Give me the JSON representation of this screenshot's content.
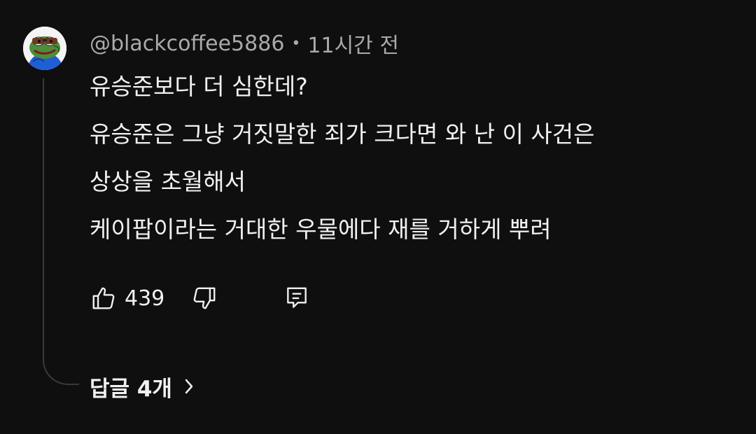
{
  "comment": {
    "author": "@blackcoffee5886",
    "separator": "•",
    "timestamp": "11시간 전",
    "avatar_icon": "pepe-frog-avatar-icon",
    "lines": [
      "유승준보다 더 심한데?",
      "유승준은 그냥 거짓말한 죄가 크다면 와 난 이 사건은",
      "상상을 초월해서",
      "케이팝이라는 거대한 우물에다 재를 거하게 뿌려"
    ],
    "like_count": "439",
    "icons": {
      "like": "thumbs-up-icon",
      "dislike": "thumbs-down-icon",
      "reply": "reply-comment-icon",
      "chevron": "chevron-right-icon"
    }
  },
  "replies": {
    "label": "답글 4개"
  },
  "colors": {
    "background": "#0f0f0f",
    "primary_text": "#f1f1f1",
    "secondary_text": "#aaaaaa",
    "thread_line": "#3a3a3a"
  }
}
